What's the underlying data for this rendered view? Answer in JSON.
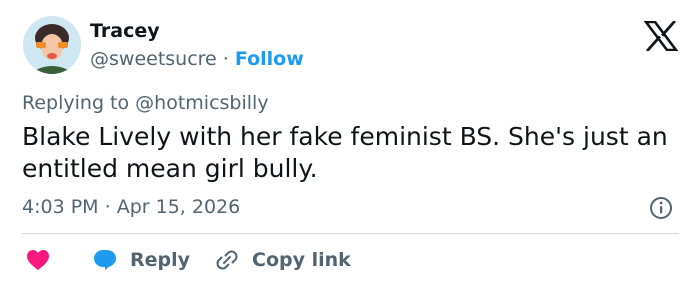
{
  "author": {
    "name": "Tracey",
    "handle": "@sweetsucre",
    "separator": "·",
    "follow_label": "Follow"
  },
  "replying": {
    "prefix": "Replying to",
    "mention": "@hotmicsbilly"
  },
  "tweet": {
    "text": "Blake Lively with her fake feminist BS. She's just an entitled mean girl bully.",
    "time": "4:03 PM",
    "separator": "·",
    "date": "Apr 15, 2026"
  },
  "actions": {
    "reply_label": "Reply",
    "copy_label": "Copy link"
  },
  "colors": {
    "accent": "#1d9bf0",
    "heart": "#f91880",
    "muted": "#536471",
    "text": "#0f1419",
    "divider": "#cfd9de"
  },
  "icons": [
    "x-logo-icon",
    "info-icon",
    "heart-icon",
    "reply-bubble-icon",
    "link-icon"
  ]
}
